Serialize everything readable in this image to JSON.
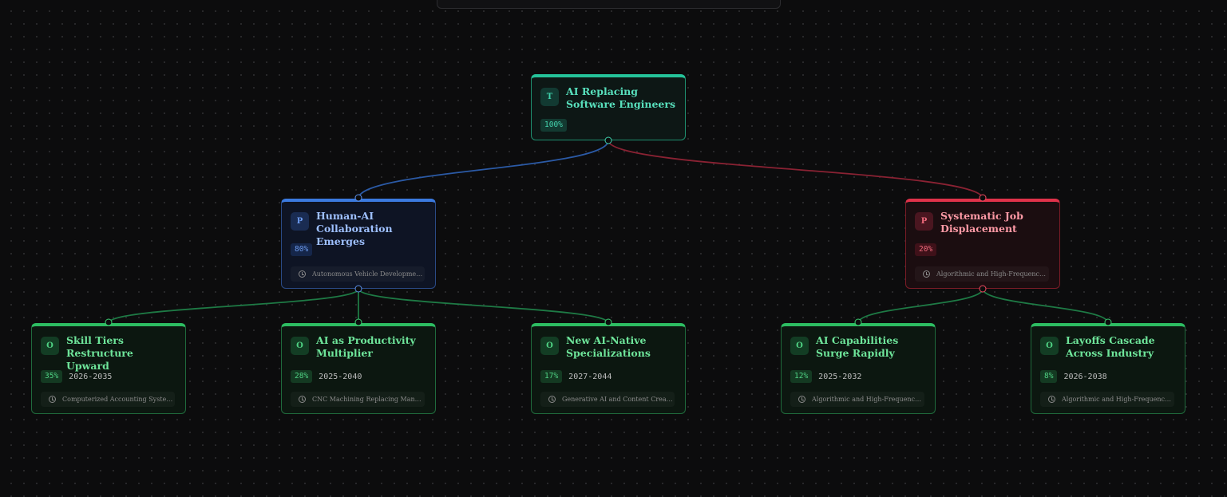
{
  "colors": {
    "background": "#0c0c0d",
    "trigger": "#25c39a",
    "primary": "#3b7ae0",
    "danger": "#e0324a",
    "outcome": "#2dbd62",
    "edge_primary": "#2b5aa6",
    "edge_danger": "#8a2233",
    "edge_outcome": "#1e7a45"
  },
  "nodes": [
    {
      "id": "root",
      "kind": "trigger",
      "badge": "T",
      "title": "AI Replacing Software Engineers",
      "pct": "100%",
      "years": "",
      "precedent": ""
    },
    {
      "id": "collab",
      "kind": "primary",
      "badge": "P",
      "title": "Human-AI Collaboration Emerges",
      "pct": "80%",
      "years": "",
      "precedent": "Autonomous Vehicle Development ..."
    },
    {
      "id": "displace",
      "kind": "danger",
      "badge": "P",
      "title": "Systematic Job Displacement",
      "pct": "20%",
      "years": "",
      "precedent": "Algorithmic and High-Frequency T..."
    },
    {
      "id": "skill",
      "kind": "outcome",
      "badge": "O",
      "title": "Skill Tiers Restructure Upward",
      "pct": "35%",
      "years": "2026-2035",
      "precedent": "Computerized Accounting Systems..."
    },
    {
      "id": "productivity",
      "kind": "outcome",
      "badge": "O",
      "title": "AI as Productivity Multiplier",
      "pct": "28%",
      "years": "2025-2040",
      "precedent": "CNC Machining Replacing Manual..."
    },
    {
      "id": "native",
      "kind": "outcome",
      "badge": "O",
      "title": "New AI-Native Specializations",
      "pct": "17%",
      "years": "2027-2044",
      "precedent": "Generative AI and Content Creatio..."
    },
    {
      "id": "surge",
      "kind": "outcome",
      "badge": "O",
      "title": "AI Capabilities Surge Rapidly",
      "pct": "12%",
      "years": "2025-2032",
      "precedent": "Algorithmic and High-Frequency T..."
    },
    {
      "id": "layoffs",
      "kind": "outcome",
      "badge": "O",
      "title": "Layoffs Cascade Across Industry",
      "pct": "8%",
      "years": "2026-2038",
      "precedent": "Algorithmic and High-Frequency T..."
    }
  ],
  "edges": [
    {
      "from": "root",
      "to": "collab",
      "kind": "primary"
    },
    {
      "from": "root",
      "to": "displace",
      "kind": "danger"
    },
    {
      "from": "collab",
      "to": "skill",
      "kind": "outcome"
    },
    {
      "from": "collab",
      "to": "productivity",
      "kind": "outcome"
    },
    {
      "from": "collab",
      "to": "native",
      "kind": "outcome"
    },
    {
      "from": "displace",
      "to": "surge",
      "kind": "outcome"
    },
    {
      "from": "displace",
      "to": "layoffs",
      "kind": "outcome"
    }
  ]
}
